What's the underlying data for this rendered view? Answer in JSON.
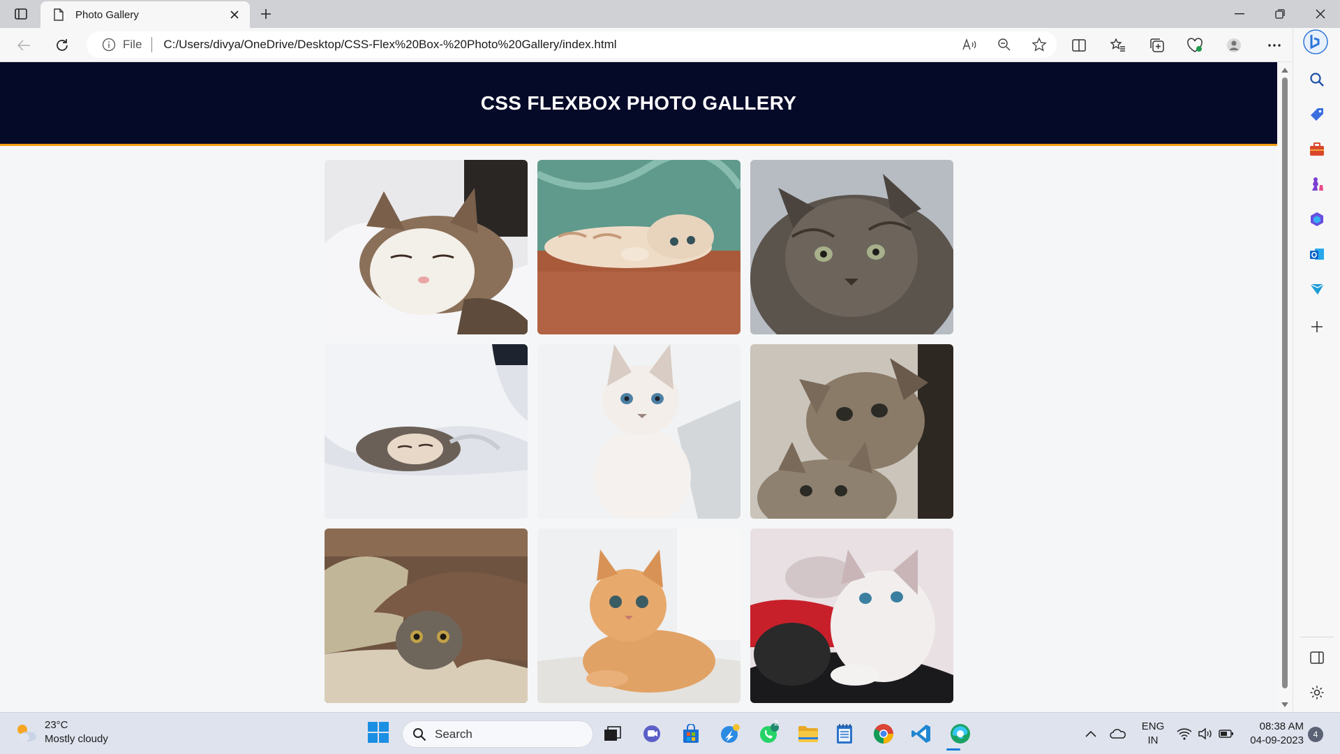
{
  "browser": {
    "tab_title": "Photo Gallery",
    "address": {
      "scheme_label": "File",
      "url": "C:/Users/divya/OneDrive/Desktop/CSS-Flex%20Box-%20Photo%20Gallery/index.html"
    }
  },
  "page": {
    "title": "CSS FLEXBOX PHOTO GALLERY",
    "photos": [
      {
        "subject": "tabby-white cat sleeping on white blanket"
      },
      {
        "subject": "cream kitten lying upside down on wooden floor"
      },
      {
        "subject": "grey tabby cat with green eyes"
      },
      {
        "subject": "kitten sleeping under white duvet"
      },
      {
        "subject": "white siamese kitten with blue eyes"
      },
      {
        "subject": "two tabby kittens"
      },
      {
        "subject": "grey kitten under brown blanket"
      },
      {
        "subject": "orange ginger kitten lying down"
      },
      {
        "subject": "white and black kittens on red blanket"
      }
    ],
    "header_bg": "#060a29",
    "accent": "#f39c12"
  },
  "taskbar": {
    "weather": {
      "temp": "23°C",
      "condition": "Mostly cloudy"
    },
    "search_label": "Search",
    "whatsapp_badge": "2",
    "language": {
      "line1": "ENG",
      "line2": "IN"
    },
    "clock": {
      "time": "08:38 AM",
      "date": "04-09-2023"
    },
    "notifications": "4"
  }
}
